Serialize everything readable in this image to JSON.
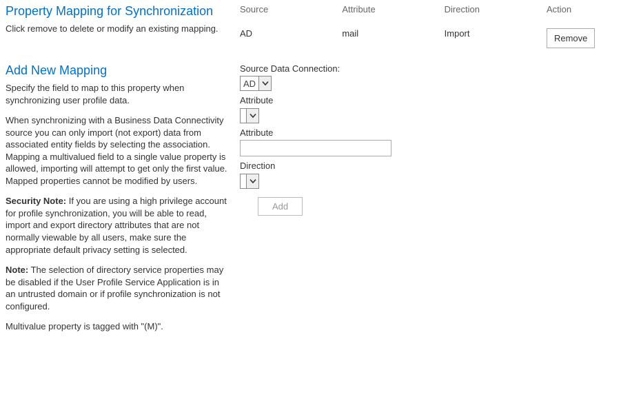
{
  "section1": {
    "title": "Property Mapping for Synchronization",
    "desc": "Click remove to delete or modify an existing mapping.",
    "table": {
      "headers": {
        "source": "Source",
        "attribute": "Attribute",
        "direction": "Direction",
        "action": "Action"
      },
      "row": {
        "source": "AD",
        "attribute": "mail",
        "direction": "Import",
        "remove": "Remove"
      }
    }
  },
  "section2": {
    "title": "Add New Mapping",
    "p1": "Specify the field to map to this property when synchronizing user profile data.",
    "p2": "When synchronizing with a Business Data Connectivity source you can only import (not export) data from associated entity fields by selecting  the association. Mapping a multivalued field to a single value property is allowed, importing will attempt to get only the first value. Mapped properties cannot be modified by users.",
    "p3a": "Security Note:",
    "p3b": " If you are using a high privilege account for profile synchronization, you will be able to read, import and export directory attributes that are not normally viewable by all users, make sure the appropriate default privacy setting is selected.",
    "p4a": "Note:",
    "p4b": " The selection of directory service properties may be disabled if the User Profile Service Application is in an untrusted domain or if profile synchronization is not configured.",
    "p5": "Multivalue property is tagged with \"(M)\".",
    "form": {
      "source_label": "Source Data Connection:",
      "source_value": "AD",
      "attribute1_label": "Attribute",
      "attribute1_value": "",
      "attribute2_label": "Attribute",
      "attribute2_value": "",
      "direction_label": "Direction",
      "direction_value": "",
      "add": "Add"
    }
  }
}
